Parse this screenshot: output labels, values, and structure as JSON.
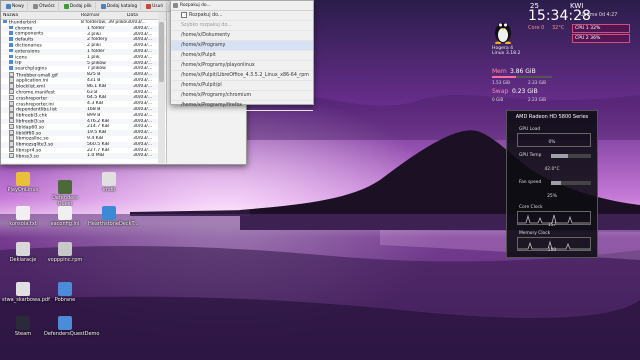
{
  "colors": {
    "sky_top": "#2a1d4a",
    "sky_mid": "#8a3aa8",
    "sky_glow": "#e0a8e8",
    "sea": "#6a3d86",
    "island": "#1c1024",
    "accent": "#d64c7a"
  },
  "file_manager": {
    "toolbar": [
      {
        "label": "Nowy",
        "icon": "new-window-icon"
      },
      {
        "label": "Otwórz",
        "icon": "open-folder-icon"
      },
      {
        "label": "Dodaj plik",
        "icon": "add-file-icon"
      },
      {
        "label": "Dodaj katalog",
        "icon": "add-folder-icon"
      },
      {
        "label": "Usuń",
        "icon": "delete-icon"
      }
    ],
    "columns": {
      "name": "Nazwa",
      "size": "Rozmiar",
      "date": "Data"
    },
    "rows": [
      {
        "name": "thunderbird",
        "size": "8 folderów, 39 plików",
        "date": "30/03/...",
        "kind": "folder"
      },
      {
        "name": "chrome",
        "size": "1 folder",
        "date": "30/03/...",
        "kind": "folder"
      },
      {
        "name": "components",
        "size": "3 pliki",
        "date": "30/03/...",
        "kind": "folder"
      },
      {
        "name": "defaults",
        "size": "2 foldery",
        "date": "30/03/...",
        "kind": "folder"
      },
      {
        "name": "dictionaries",
        "size": "2 pliki",
        "date": "30/03/...",
        "kind": "folder"
      },
      {
        "name": "extensions",
        "size": "1 folder",
        "date": "30/03/...",
        "kind": "folder"
      },
      {
        "name": "icons",
        "size": "1 plik",
        "date": "30/03/...",
        "kind": "folder"
      },
      {
        "name": "isp",
        "size": "5 plików",
        "date": "30/03/...",
        "kind": "folder"
      },
      {
        "name": "searchplugins",
        "size": "7 plików",
        "date": "30/03/...",
        "kind": "folder"
      },
      {
        "name": "Throbber-small.gif",
        "size": "825 B",
        "date": "30/03/...",
        "kind": "file"
      },
      {
        "name": "application.ini",
        "size": "431 B",
        "date": "30/03/...",
        "kind": "file"
      },
      {
        "name": "blocklist.xml",
        "size": "86.1 KiB",
        "date": "30/03/...",
        "kind": "file"
      },
      {
        "name": "chrome.manifest",
        "size": "63 B",
        "date": "30/03/...",
        "kind": "file"
      },
      {
        "name": "crashreporter",
        "size": "64.5 KiB",
        "date": "30/03/...",
        "kind": "file"
      },
      {
        "name": "crashreporter.ini",
        "size": "4.3 KiB",
        "date": "30/03/...",
        "kind": "file"
      },
      {
        "name": "dependentlibs.list",
        "size": "168 B",
        "date": "30/03/...",
        "kind": "file"
      },
      {
        "name": "libfreebl3.chk",
        "size": "899 B",
        "date": "30/03/...",
        "kind": "file"
      },
      {
        "name": "libfreebl3.so",
        "size": "476.2 KiB",
        "date": "30/03/...",
        "kind": "file"
      },
      {
        "name": "libldap60.so",
        "size": "214.7 KiB",
        "date": "30/03/...",
        "kind": "file"
      },
      {
        "name": "libldif60.so",
        "size": "19.5 KiB",
        "date": "30/03/...",
        "kind": "file"
      },
      {
        "name": "libmozalloc.so",
        "size": "9.4 KiB",
        "date": "30/03/...",
        "kind": "file"
      },
      {
        "name": "libmozsqlite3.so",
        "size": "560.5 KiB",
        "date": "30/03/...",
        "kind": "file"
      },
      {
        "name": "libnspr4.so",
        "size": "227.7 KiB",
        "date": "30/03/...",
        "kind": "file"
      },
      {
        "name": "libnss3.so",
        "size": "1.0 MiB",
        "date": "30/03/...",
        "kind": "file"
      }
    ]
  },
  "dropdown": {
    "header": "Rozpakuj do...",
    "items": [
      {
        "text": "Szybko rozpakuj do...",
        "dim": true,
        "check": false
      },
      {
        "text": "/home/x/Dokumenty",
        "dim": false,
        "check": false
      },
      {
        "text": "/home/x/Programy",
        "dim": false,
        "check": false,
        "hl": true
      },
      {
        "text": "/home/x/Pulpit",
        "dim": false,
        "check": false
      },
      {
        "text": "/home/x/Programy/playonlinux",
        "dim": false,
        "check": false
      },
      {
        "text": "/home/x/Pulpit/LibreOffice_4.3.5.2_Linux_x86-64_rpm",
        "dim": false,
        "check": false
      },
      {
        "text": "/home/x/Pulpit/pl",
        "dim": false,
        "check": false
      },
      {
        "text": "/home/x/Programy/chromium",
        "dim": false,
        "check": false
      },
      {
        "text": "/home/x/Programy/firefox",
        "dim": false,
        "check": false
      }
    ],
    "top_item": "Rozpakuj do..."
  },
  "desktop_icons": [
    {
      "label": "PlayOnLinux",
      "name": "playonlinux-icon",
      "color": "#e8c03a"
    },
    {
      "label": "Defenders Quest",
      "name": "defenders-quest-icon",
      "color": "#4a6a3a"
    },
    {
      "label": "imdb",
      "name": "imdb-icon",
      "color": "#e0e0e0"
    },
    {
      "label": "konsola.txt",
      "name": "text-file-icon",
      "color": "#f0f0f0"
    },
    {
      "label": "eaconfig.ini",
      "name": "config-file-icon",
      "color": "#f0f0f0"
    },
    {
      "label": "HearthstoneDeckT...",
      "name": "archive-icon",
      "color": "#3a8ad6"
    },
    {
      "label": "Deklaracje",
      "name": "document-icon",
      "color": "#d8d8d8"
    },
    {
      "label": "vopppinc.rpm",
      "name": "package-icon",
      "color": "#c8c8c8"
    },
    {
      "label": "stwa_skarbowa.pdf",
      "name": "pdf-icon",
      "color": "#e0e0e0"
    },
    {
      "label": "Pobrane",
      "name": "folder-icon",
      "color": "#4b8bd8"
    },
    {
      "label": "Steam",
      "name": "steam-icon",
      "color": "#2a2a3a"
    },
    {
      "label": "DefendersQuestDemo",
      "name": "folder-icon",
      "color": "#4b8bd8"
    }
  ],
  "conky": {
    "day": "25",
    "month": "KWI",
    "time": "15:34:28",
    "uptime": "Uptime 0d 4:27",
    "core_label": "Core 0",
    "core_temp": "32°C",
    "cpu1": "CPU 1  32%",
    "cpu2": "CPU 2  36%",
    "host": "Hogera 4",
    "kernel": "Linux 3.18.2",
    "mem_label": "Mem",
    "mem_value": "3.86 GiB",
    "mem_used": "1.53 GiB",
    "mem_free": "2.33 GiB",
    "mem_fraction": 0.4,
    "swap_label": "Swap",
    "swap_value": "0.23 GiB",
    "swap_used": "0 GiB",
    "swap_free": "2.23 GiB"
  },
  "gpu": {
    "title": "AMD Radeon HD 5800 Series",
    "gpu_load_label": "GPU Load",
    "gpu_load_value": "0%",
    "gpu_temp_label": "GPU Temp",
    "gpu_temp_value": "42.0°C",
    "fan_label": "Fan speed",
    "fan_value": "25%",
    "core_label": "Core Clock",
    "core_value": "157",
    "mem_label": "Memory Clock",
    "mem_value": "300"
  }
}
